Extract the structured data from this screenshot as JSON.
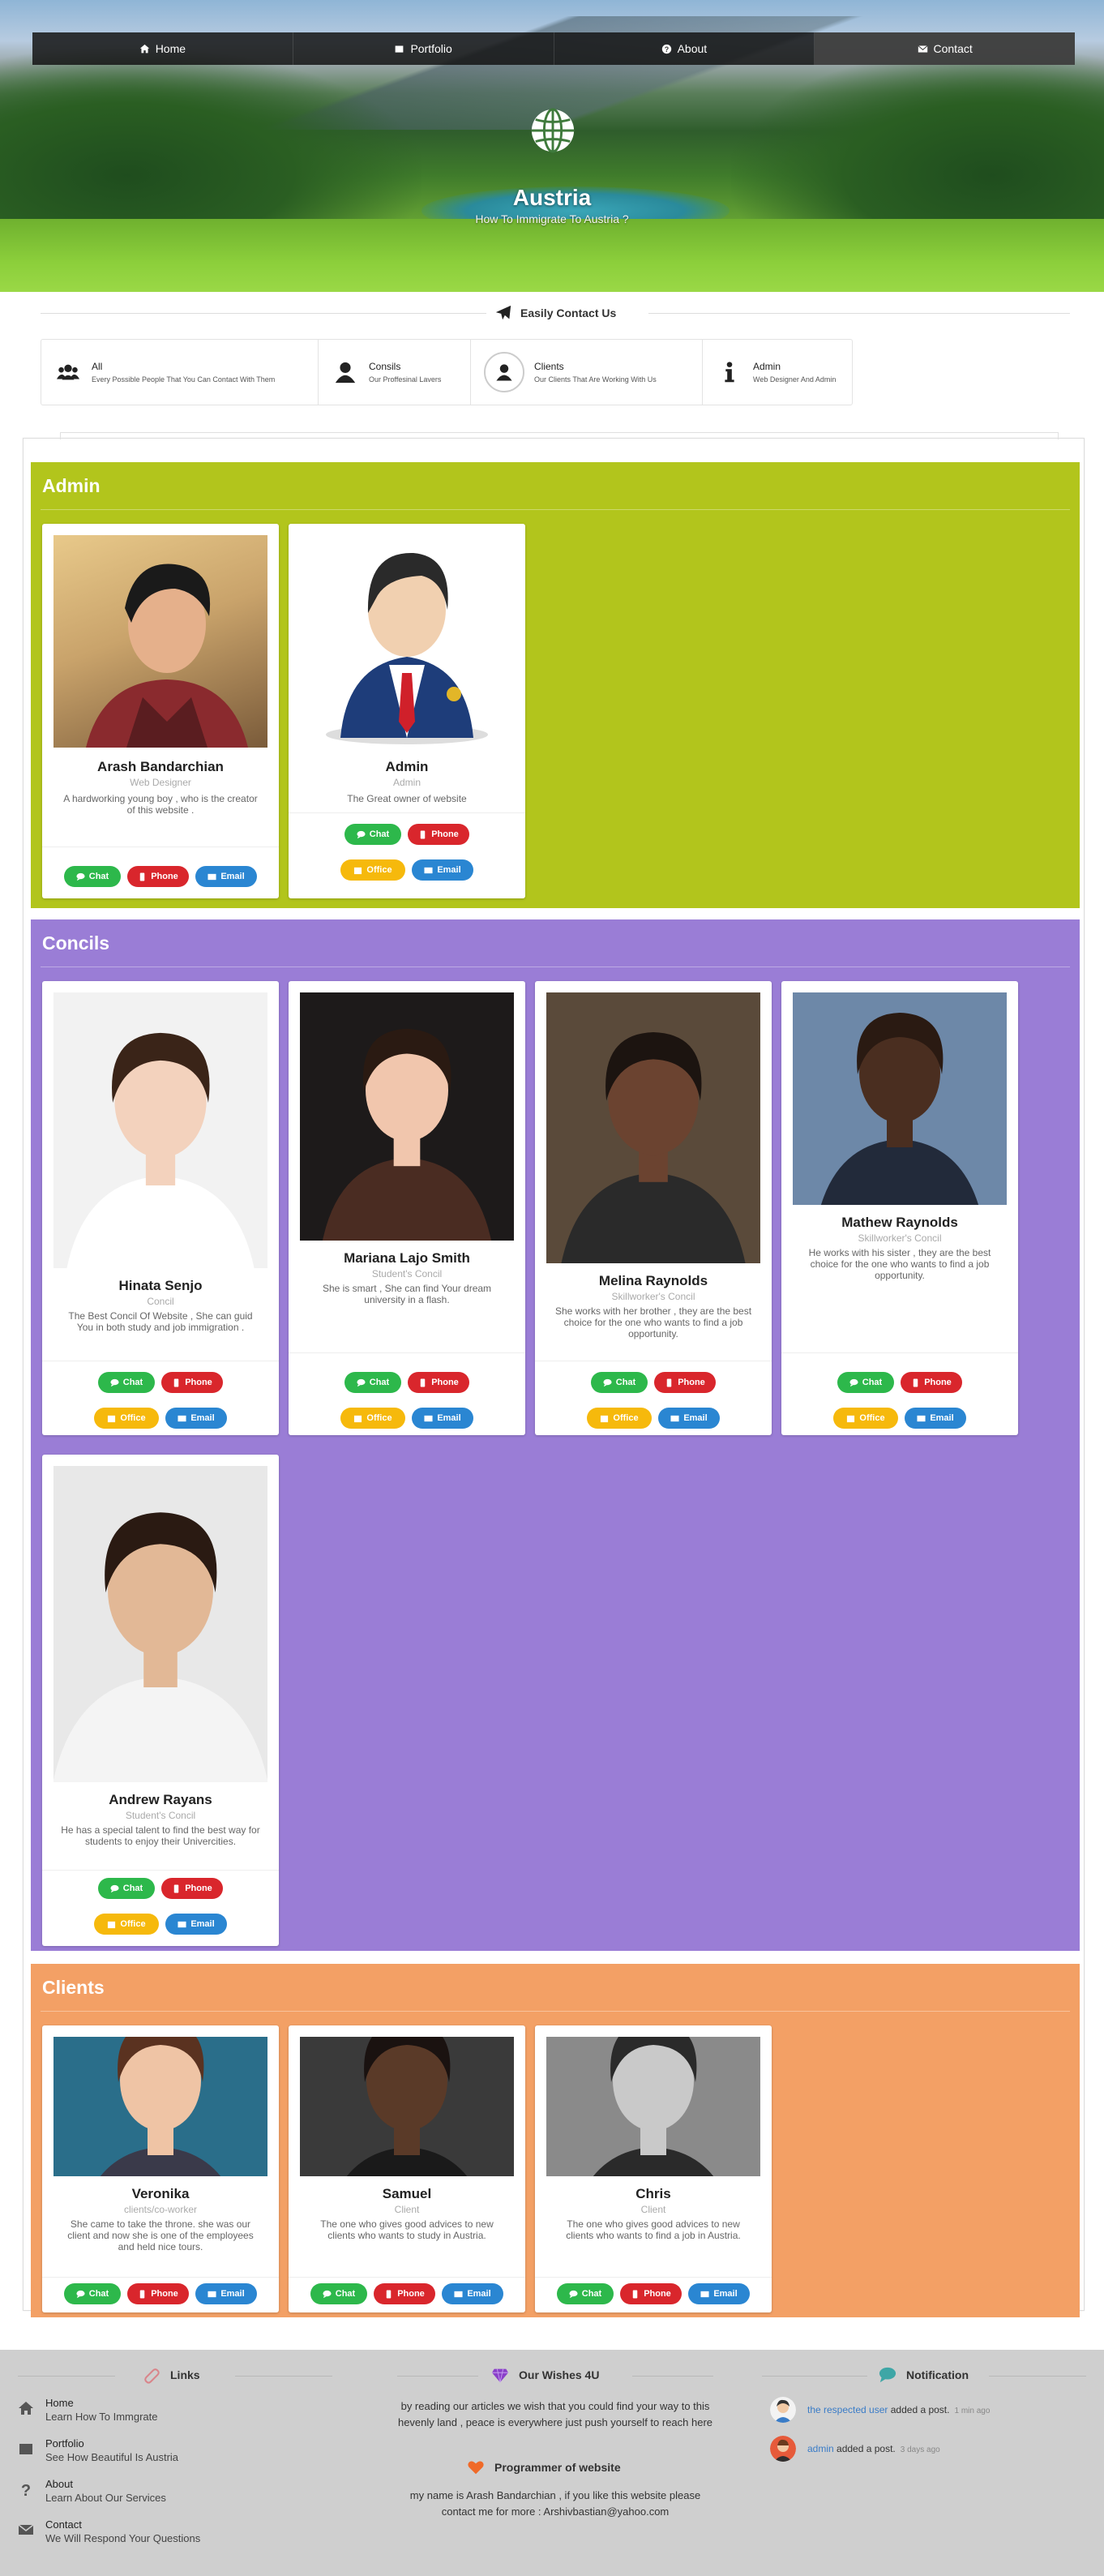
{
  "nav": {
    "items": [
      {
        "label": "Home",
        "icon": "home-icon"
      },
      {
        "label": "Portfolio",
        "icon": "portfolio-icon"
      },
      {
        "label": "About",
        "icon": "question-icon"
      },
      {
        "label": "Contact",
        "icon": "envelope-icon"
      }
    ]
  },
  "hero": {
    "title": "Austria",
    "subtitle": "How To Immigrate To Austria ?",
    "icon": "globe-icon"
  },
  "contact_heading": {
    "label": "Easily Contact Us",
    "icon": "paper-plane-icon"
  },
  "filters": [
    {
      "title": "All",
      "desc": "Every Possible People That You Can Contact With Them",
      "icon": "users-icon"
    },
    {
      "title": "Consils",
      "desc": "Our Proffesinal Lavers",
      "icon": "user-icon"
    },
    {
      "title": "Clients",
      "desc": "Our Clients That Are Working With Us",
      "icon": "user-circle-icon"
    },
    {
      "title": "Admin",
      "desc": "Web Designer And Admin",
      "icon": "info-icon"
    }
  ],
  "buttons": {
    "chat": "Chat",
    "phone": "Phone",
    "email": "Email",
    "office": "Office"
  },
  "sections": {
    "admin": {
      "title": "Admin",
      "color": "#b2c51c",
      "people": [
        {
          "name": "Arash Bandarchian",
          "role": "Web Designer",
          "desc": "A hardworking young boy , who is the creator of this website ."
        },
        {
          "name": "Admin",
          "role": "Admin",
          "desc": "The Great owner of website"
        }
      ]
    },
    "concils": {
      "title": "Concils",
      "color": "#9a7dd6",
      "people": [
        {
          "name": "Hinata Senjo",
          "role": "Concil",
          "desc": "The Best Concil Of Website , She can guid You in both study and job immigration ."
        },
        {
          "name": "Mariana Lajo Smith",
          "role": "Student's Concil",
          "desc": "She is smart , She can find Your dream university in a flash."
        },
        {
          "name": "Melina Raynolds",
          "role": "Skillworker's Concil",
          "desc": "She works with her brother , they are the best choice for the one who wants to find a job opportunity."
        },
        {
          "name": "Mathew Raynolds",
          "role": "Skillworker's Concil",
          "desc": "He works with his sister , they are the best choice for the one who wants to find a job opportunity."
        },
        {
          "name": "Andrew Rayans",
          "role": "Student's Concil",
          "desc": "He has a special talent to find the best way for students to enjoy their Univercities."
        }
      ]
    },
    "clients": {
      "title": "Clients",
      "color": "#f3a065",
      "people": [
        {
          "name": "Veronika",
          "role": "clients/co-worker",
          "desc": "She came to take the throne. she was our client and now she is one of the employees and held nice tours."
        },
        {
          "name": "Samuel",
          "role": "Client",
          "desc": "The one who gives good advices to new clients who wants to study in Austria."
        },
        {
          "name": "Chris",
          "role": "Client",
          "desc": "The one who gives good advices to new clients who wants to find a job in Austria."
        }
      ]
    }
  },
  "footer": {
    "links_title": "Links",
    "links": [
      {
        "title": "Home",
        "sub": "Learn How To Immgrate",
        "icon": "home-icon"
      },
      {
        "title": "Portfolio",
        "sub": "See How Beautiful Is Austria",
        "icon": "portfolio-icon"
      },
      {
        "title": "About",
        "sub": "Learn About Our Services",
        "icon": "question-icon"
      },
      {
        "title": "Contact",
        "sub": "We Will Respond Your Questions",
        "icon": "envelope-icon"
      }
    ],
    "wishes_title": "Our Wishes 4U",
    "wishes_text": "by reading our articles we wish that you could find your way to this hevenly land , peace is everywhere just push yourself to reach here",
    "programmer_title": "Programmer of website",
    "programmer_text": "my name is Arash Bandarchian , if you like this website please contact me for more : Arshivbastian@yahoo.com",
    "notification_title": "Notification",
    "notifications": [
      {
        "who": "the respected user",
        "action": "added a post.",
        "time": "1 min ago"
      },
      {
        "who": "admin",
        "action": "added a post.",
        "time": "3 days ago"
      }
    ]
  }
}
